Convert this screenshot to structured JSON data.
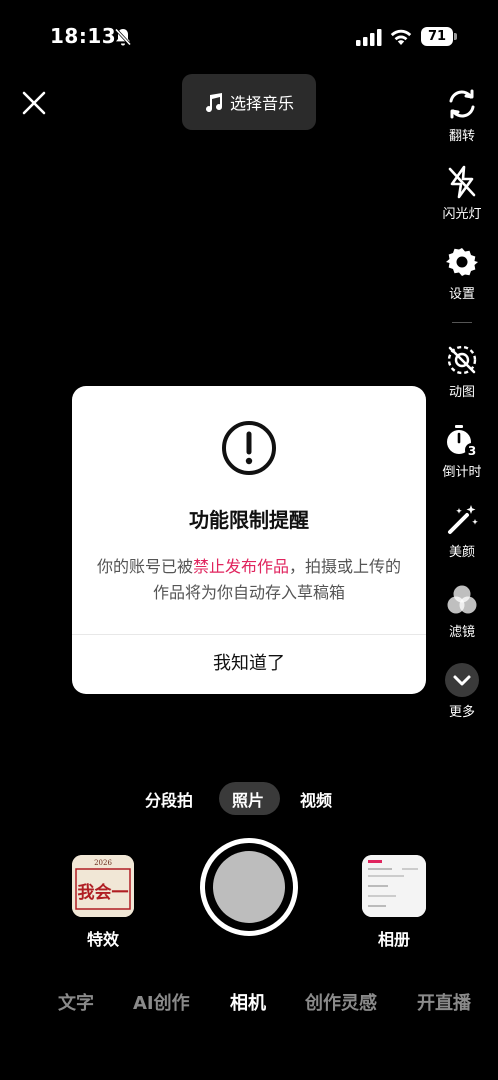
{
  "status_bar": {
    "time": "18:13",
    "battery": "71"
  },
  "top": {
    "music_label": "选择音乐"
  },
  "toolbar": [
    {
      "label": "翻转",
      "icon": "flip-camera-icon"
    },
    {
      "label": "闪光灯",
      "icon": "flash-off-icon"
    },
    {
      "label": "设置",
      "icon": "gear-icon"
    },
    {
      "label": "动图",
      "icon": "motion-off-icon"
    },
    {
      "label": "倒计时",
      "icon": "timer-icon"
    },
    {
      "label": "美颜",
      "icon": "magic-wand-icon"
    },
    {
      "label": "滤镜",
      "icon": "filter-icon"
    },
    {
      "label": "更多",
      "icon": "chevron-down-icon"
    }
  ],
  "dialog": {
    "title": "功能限制提醒",
    "message_prefix": "你的账号已被",
    "message_highlight": "禁止发布作品",
    "message_suffix": "，拍摄或上传的作品将为你自动存入草稿箱",
    "button": "我知道了"
  },
  "modes": {
    "segment": "分段拍",
    "photo": "照片",
    "video": "视频",
    "selected": "照片"
  },
  "capture": {
    "effects_label": "特效",
    "album_label": "相册"
  },
  "effect_thumb": {
    "year": "2026",
    "text": "我会一"
  },
  "bottom_tabs": {
    "text": "文字",
    "ai": "AI创作",
    "camera": "相机",
    "inspiration": "创作灵感",
    "live": "开直播",
    "selected": "相机"
  },
  "colors": {
    "highlight": "#e0245e",
    "dialog_bg": "#ffffff",
    "background": "#000000"
  }
}
